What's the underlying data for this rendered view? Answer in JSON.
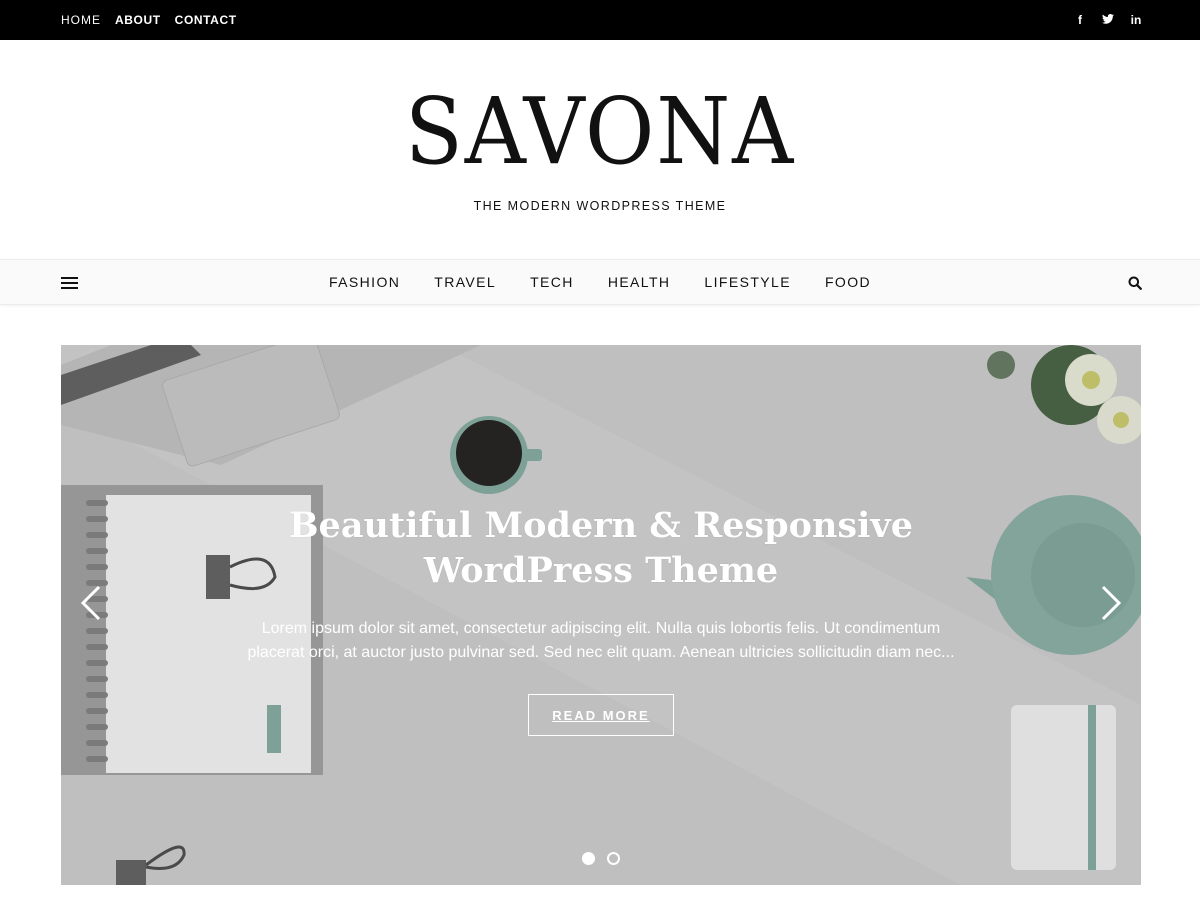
{
  "top_nav": {
    "items": [
      "HOME",
      "ABOUT",
      "CONTACT"
    ]
  },
  "social": {
    "icons": [
      "facebook-icon",
      "twitter-icon",
      "linkedin-icon"
    ],
    "glyphs": [
      "f",
      "t",
      "in"
    ]
  },
  "header": {
    "logo": "SAVONA",
    "tagline": "THE MODERN WORDPRESS THEME"
  },
  "main_nav": {
    "items": [
      "FASHION",
      "TRAVEL",
      "TECH",
      "HEALTH",
      "LIFESTYLE",
      "FOOD"
    ]
  },
  "slider": {
    "title_line1": "Beautiful Modern & Responsive",
    "title_line2": "WordPress Theme",
    "text": "Lorem ipsum dolor sit amet, consectetur adipiscing elit. Nulla quis lobortis felis. Ut condimentum placerat orci, at auctor justo pulvinar sed. Sed nec elit quam. Aenean ultricies sollicitudin diam nec...",
    "button_label": "READ MORE",
    "slide_count": 2,
    "active_slide": 1
  },
  "colors": {
    "topbar": "#000000",
    "accent_teal": "#7fa79b"
  }
}
